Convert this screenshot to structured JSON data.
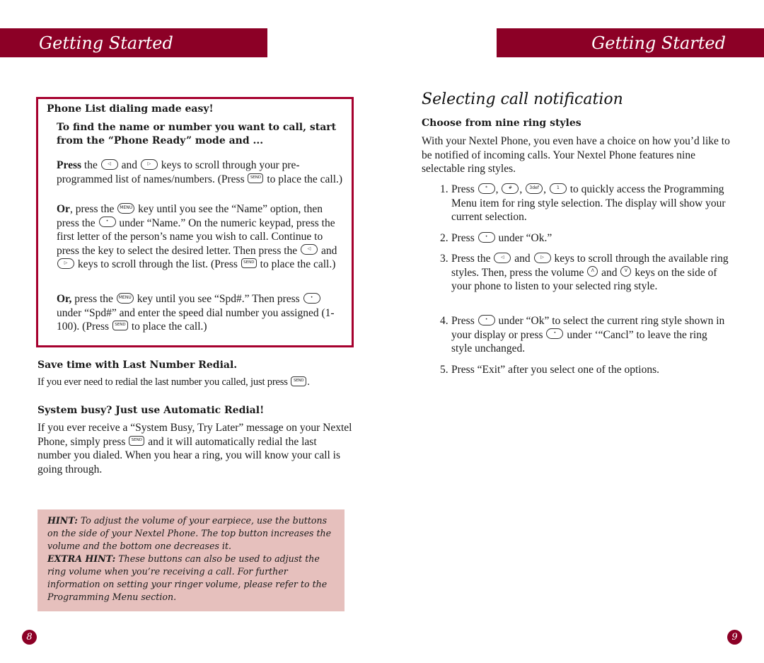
{
  "left_page": {
    "header": "Getting Started",
    "page_number": "8",
    "phone_list_box": {
      "title": "Phone List dialing made easy!",
      "intro": "To find the name or number you want to call, start from the “Phone Ready” mode and ...",
      "p1": {
        "lead": "Press",
        "t1": " the ",
        "t2": " and ",
        "t3": " keys to scroll through your pre-programmed list of names/numbers. (Press ",
        "t4": " to place the call.)"
      },
      "p2": {
        "lead": "Or",
        "t1": ", press the ",
        "t2": " key until you see the “Name” option, then press the ",
        "t3": " under “Name.” On the numeric keypad, press the first letter of the person’s name you wish to call. Continue to press the key to select the desired letter.  Then press the ",
        "t4": " and ",
        "t5": " keys to scroll through the list. (Press ",
        "t6": "  to place the call.)"
      },
      "p3": {
        "lead": "Or,",
        "t1": " press the ",
        "t2": " key until you see “Spd#.”  Then press ",
        "t3": " under “Spd#” and enter the speed dial number you assigned (1-100).  (Press ",
        "t4": " to place the call.)"
      }
    },
    "redial": {
      "title": "Save time with Last Number Redial.",
      "text": "If you ever need to redial the last number you called, just press ",
      "end": "."
    },
    "auto_redial": {
      "title": "System busy?  Just use Automatic Redial!",
      "t1": "If you ever receive a “System Busy, Try Later” message on your Nextel Phone, simply press ",
      "t2": "  and it will automatically redial the last number you dialed.  When you hear a ring, you will know your call is going through."
    },
    "hint": {
      "label": "HINT:",
      "text": "  To adjust the volume of your earpiece, use the buttons on the side of your Nextel Phone.  The top button increases the volume and the bottom one decreases it.",
      "extra_label": "EXTRA HINT:",
      "extra_text": "  These buttons can also be used to adjust the ring volume when you’re receiving a call.  For further information on setting your ringer volume, please refer to the Programming Menu section."
    }
  },
  "right_page": {
    "header": "Getting Started",
    "page_number": "9",
    "section_title": "Selecting call notification",
    "subheading": "Choose from nine ring styles",
    "intro": "With your Nextel Phone, you even have a choice on how you’d like to be notified of incoming calls.  Your Nextel Phone features nine selectable ring styles.",
    "steps": [
      {
        "num": "1.",
        "t1": "Press ",
        "t2": ", ",
        "t3": ", ",
        "t4": ", ",
        "t5": " to quickly access the Programming Menu item for ring style selection. The display will show your current selection."
      },
      {
        "num": "2.",
        "t1": "Press ",
        "t2": " under “Ok.”"
      },
      {
        "num": "3.",
        "t1": "Press the ",
        "t2": " and ",
        "t3": " keys to scroll through the available ring styles.  Then, press the volume ",
        "t4": " and ",
        "t5": " keys on the side of your phone to listen to your selected ring style."
      },
      {
        "num": "4.",
        "t1": "Press ",
        "t2": " under “Ok” to select the current ring style shown in your display or press ",
        "t3": " under ‘“Cancl” to leave the ring style unchanged."
      },
      {
        "num": "5.",
        "t1": "Press “Exit” after you select one of the options."
      }
    ]
  },
  "keys": {
    "send": "SEND",
    "menu": "MENU",
    "left": "◁",
    "right": "▷",
    "select": "•",
    "star": "*",
    "pound": "#",
    "three": "3def",
    "one": "1",
    "vol_up": "Λ",
    "vol_down": "V"
  },
  "colors": {
    "brand": "#8c0026",
    "box_border": "#a6002e",
    "hint_bg": "#e6c0bd"
  }
}
